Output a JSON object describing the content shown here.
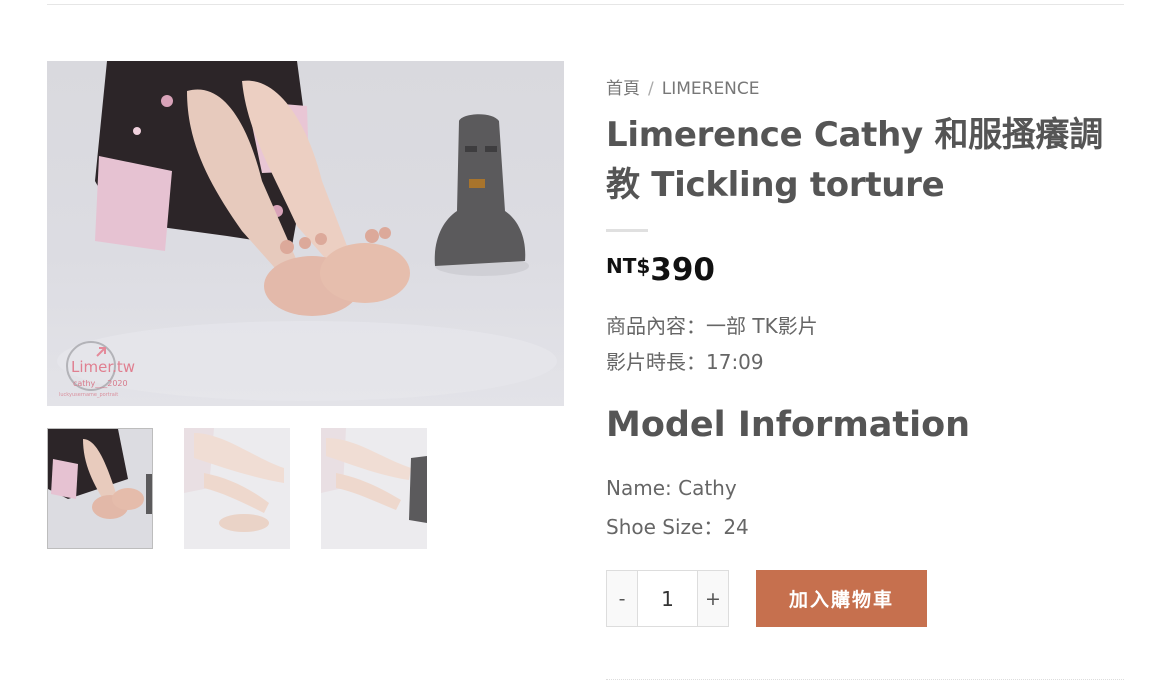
{
  "breadcrumb": {
    "home": "首頁",
    "separator": "/",
    "category": "LIMERENCE"
  },
  "product": {
    "title": "Limerence Cathy 和服搔癢調教 Tickling torture",
    "price_currency": "NT$",
    "price_amount": "390",
    "description": [
      "商品內容：一部 TK影片",
      "影片時長：17:09"
    ]
  },
  "model_info": {
    "heading": "Model Information",
    "lines": [
      "Name: Cathy",
      "Shoe Size：24"
    ]
  },
  "gallery": {
    "watermark_brand": "Limer.tw",
    "watermark_line": "cathy___2020",
    "watermark_small": "luckyusername_portrait"
  },
  "cart": {
    "minus_label": "-",
    "plus_label": "+",
    "quantity": "1",
    "add_to_cart_label": "加入購物車"
  },
  "colors": {
    "accent_button": "#c6704e",
    "text_main": "#555555",
    "price": "#111111"
  }
}
